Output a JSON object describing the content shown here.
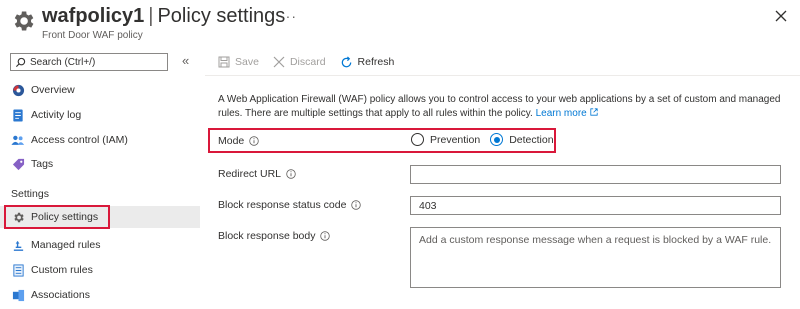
{
  "header": {
    "resource_name": "wafpolicy1",
    "separator": "|",
    "page_name": "Policy settings",
    "subtitle": "Front Door WAF policy",
    "more_label": "···"
  },
  "sidebar": {
    "search_placeholder": "Search (Ctrl+/)",
    "collapse_label": "«",
    "items_top": [
      {
        "label": "Overview",
        "icon": "overview-icon"
      },
      {
        "label": "Activity log",
        "icon": "activity-log-icon"
      },
      {
        "label": "Access control (IAM)",
        "icon": "people-icon"
      },
      {
        "label": "Tags",
        "icon": "tag-icon"
      }
    ],
    "section_label": "Settings",
    "items_settings": [
      {
        "label": "Policy settings",
        "icon": "gear-icon",
        "active": true
      },
      {
        "label": "Managed rules",
        "icon": "managed-rules-icon"
      },
      {
        "label": "Custom rules",
        "icon": "custom-rules-icon"
      },
      {
        "label": "Associations",
        "icon": "associations-icon"
      }
    ]
  },
  "toolbar": {
    "save_label": "Save",
    "discard_label": "Discard",
    "refresh_label": "Refresh"
  },
  "main": {
    "description": "A Web Application Firewall (WAF) policy allows you to control access to your web applications by a set of custom and managed rules. There are multiple settings that apply to all rules within the policy.",
    "learn_more": "Learn more",
    "mode_label": "Mode",
    "mode_options": [
      "Prevention",
      "Detection"
    ],
    "mode_selected": "Detection",
    "redirect_url_label": "Redirect URL",
    "redirect_url_value": "",
    "block_status_label": "Block response status code",
    "block_status_value": "403",
    "block_body_label": "Block response body",
    "block_body_placeholder": "Add a custom response message when a request is blocked by a WAF rule."
  },
  "colors": {
    "accent": "#0078d4",
    "highlight": "#d9183a",
    "active_bg": "#ebebeb"
  }
}
